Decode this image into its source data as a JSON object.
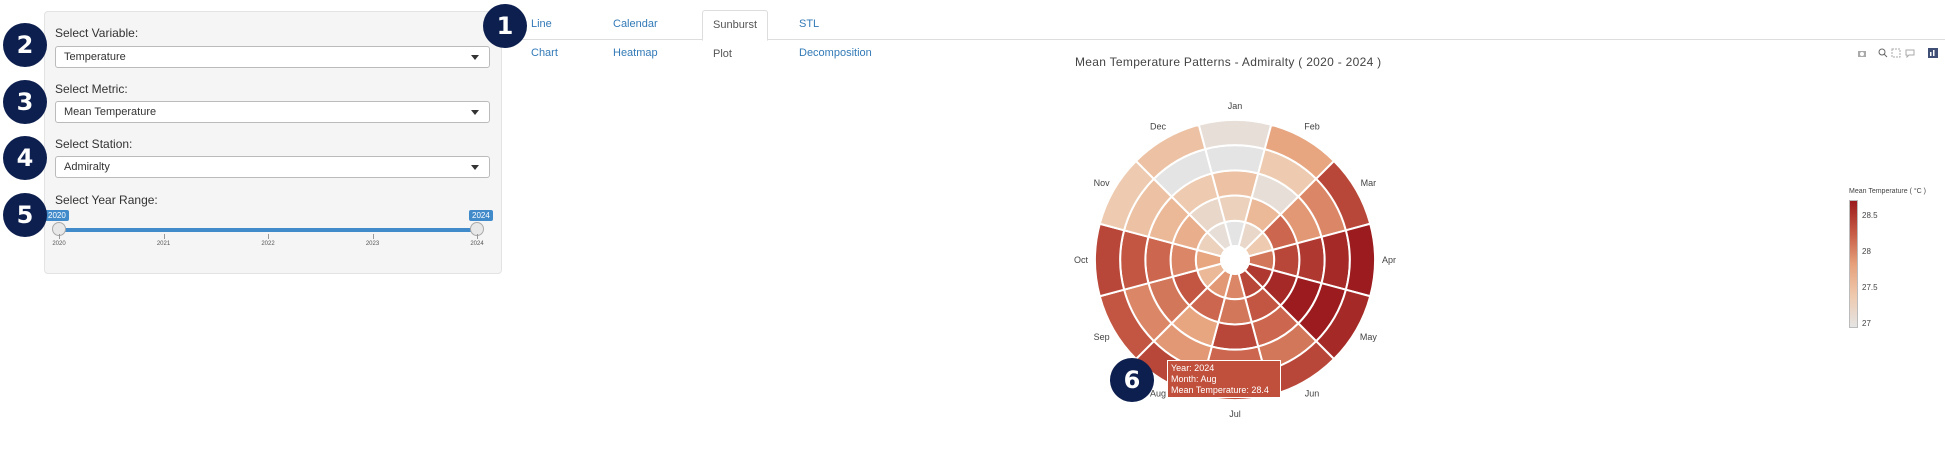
{
  "sidebar": {
    "variable_label": "Select Variable:",
    "variable_value": "Temperature",
    "metric_label": "Select Metric:",
    "metric_value": "Mean Temperature",
    "station_label": "Select Station:",
    "station_value": "Admiralty",
    "year_label": "Select Year Range:",
    "year_start": "2020",
    "year_end": "2024",
    "year_ticks": [
      "2020",
      "2021",
      "2022",
      "2023",
      "2024"
    ]
  },
  "tabs": [
    {
      "label": "Line Chart"
    },
    {
      "label": "Calendar Heatmap"
    },
    {
      "label": "Sunburst Plot"
    },
    {
      "label": "STL Decomposition"
    }
  ],
  "badges": [
    "1",
    "2",
    "3",
    "4",
    "5",
    "6"
  ],
  "chart_data": {
    "type": "sunburst",
    "title": "Mean Temperature Patterns - Admiralty ( 2020 - 2024 )",
    "months": [
      "Jan",
      "Feb",
      "Mar",
      "Apr",
      "May",
      "Jun",
      "Jul",
      "Aug",
      "Sep",
      "Oct",
      "Nov",
      "Dec"
    ],
    "years": [
      2020,
      2021,
      2022,
      2023,
      2024
    ],
    "values": [
      [
        27.0,
        27.2,
        27.4,
        28.1,
        28.5,
        28.4,
        28.0,
        27.9,
        27.6,
        27.8,
        27.3,
        27.1
      ],
      [
        27.3,
        27.6,
        28.2,
        28.4,
        28.6,
        28.3,
        28.1,
        28.2,
        28.3,
        28.0,
        27.7,
        27.2
      ],
      [
        27.5,
        27.1,
        27.9,
        28.5,
        28.7,
        28.2,
        28.4,
        27.8,
        28.1,
        28.2,
        27.6,
        27.4
      ],
      [
        27.0,
        27.4,
        28.0,
        28.6,
        28.8,
        28.1,
        28.2,
        27.9,
        28.0,
        28.3,
        27.5,
        27.0
      ],
      [
        27.1,
        27.8,
        28.4,
        28.7,
        28.6,
        28.4,
        28.3,
        28.4,
        28.3,
        28.4,
        27.4,
        27.5
      ]
    ],
    "colorbar_title": "Mean Temperature ( °C )",
    "colorbar_ticks": [
      "28.5",
      "28",
      "27.5",
      "27"
    ],
    "color_range": [
      27.0,
      28.7
    ],
    "tooltip": {
      "year": "Year: 2024",
      "month": "Month: Aug",
      "value": "Mean Temperature: 28.4 °C"
    }
  }
}
